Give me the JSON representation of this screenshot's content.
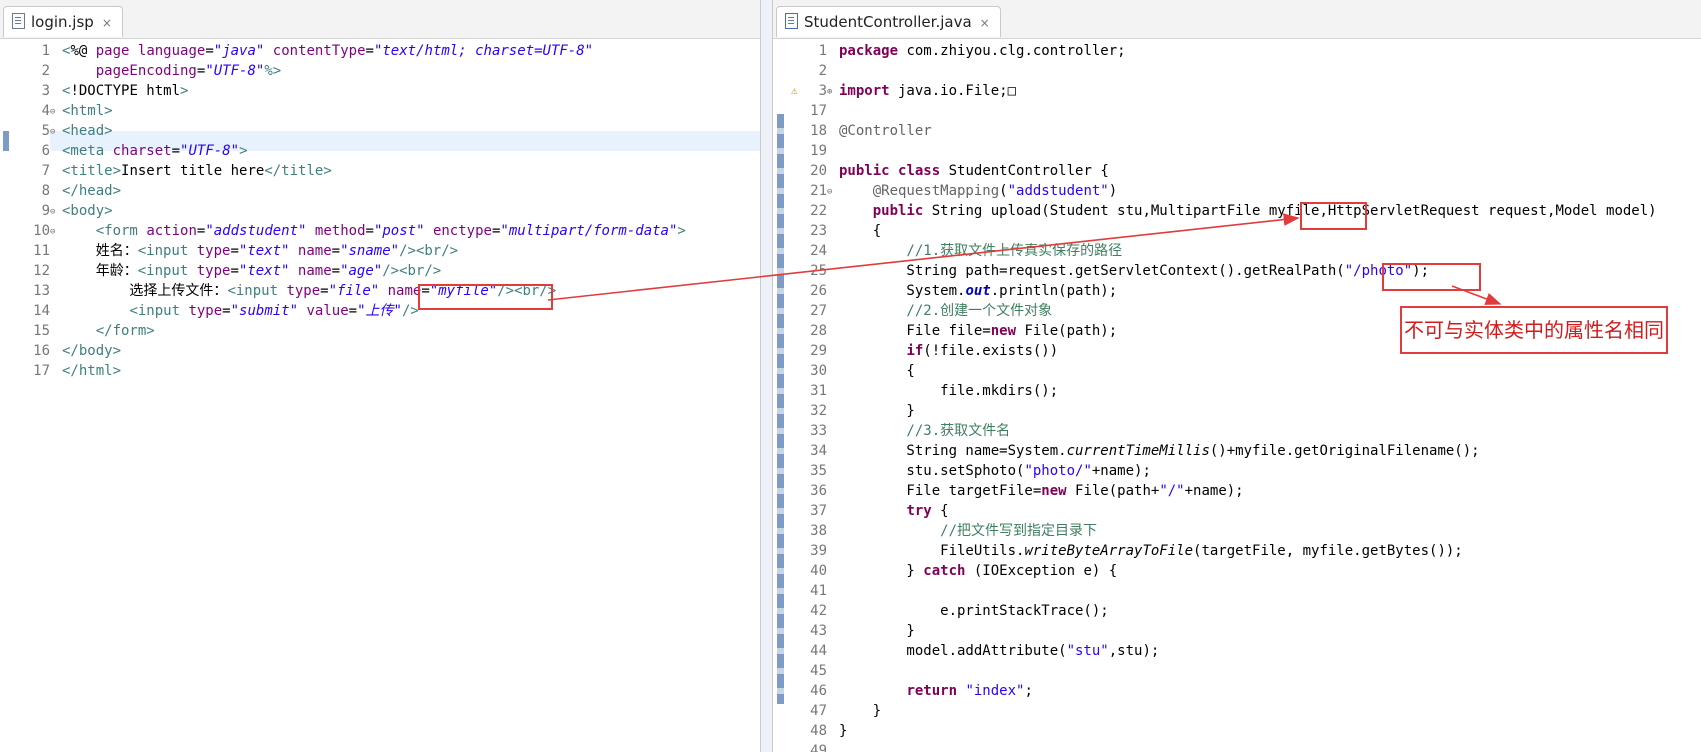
{
  "left": {
    "tab_title": "login.jsp",
    "tab_close": "×",
    "lines": [
      {
        "n": "1",
        "code": "<%@ page language=\"java\" contentType=\"text/html; charset=UTF-8\""
      },
      {
        "n": "2",
        "code": "    pageEncoding=\"UTF-8\"%>"
      },
      {
        "n": "3",
        "code": "<!DOCTYPE html>"
      },
      {
        "n": "4",
        "code": "<html>",
        "fold": "⊖"
      },
      {
        "n": "5",
        "code": "<head>",
        "fold": "⊖"
      },
      {
        "n": "6",
        "code": "<meta charset=\"UTF-8\">"
      },
      {
        "n": "7",
        "code": "<title>Insert title here</title>"
      },
      {
        "n": "8",
        "code": "</head>"
      },
      {
        "n": "9",
        "code": "<body>",
        "fold": "⊖"
      },
      {
        "n": "10",
        "code": "    <form action=\"addstudent\" method=\"post\" enctype=\"multipart/form-data\">",
        "fold": "⊖"
      },
      {
        "n": "11",
        "code": "    姓名：<input type=\"text\" name=\"sname\"/><br/>"
      },
      {
        "n": "12",
        "code": "    年龄：<input type=\"text\" name=\"age\"/><br/>"
      },
      {
        "n": "13",
        "code": "        选择上传文件：<input type=\"file\" name=\"myfile\"/><br/>"
      },
      {
        "n": "14",
        "code": "        <input type=\"submit\" value=\"上传\"/>"
      },
      {
        "n": "15",
        "code": "    </form>"
      },
      {
        "n": "16",
        "code": "</body>"
      },
      {
        "n": "17",
        "code": "</html>"
      }
    ]
  },
  "right": {
    "tab_title": "StudentController.java",
    "tab_close": "×",
    "lines": [
      {
        "n": "1",
        "code": "package com.zhiyou.clg.controller;"
      },
      {
        "n": "2",
        "code": ""
      },
      {
        "n": "3",
        "code": "import java.io.File;□",
        "fold": "⊕"
      },
      {
        "n": "17",
        "code": ""
      },
      {
        "n": "18",
        "code": "@Controller"
      },
      {
        "n": "19",
        "code": ""
      },
      {
        "n": "20",
        "code": "public class StudentController {"
      },
      {
        "n": "21",
        "code": "    @RequestMapping(\"addstudent\")",
        "fold": "⊖"
      },
      {
        "n": "22",
        "code": "    public String upload(Student stu,MultipartFile myfile,HttpServletRequest request,Model model)"
      },
      {
        "n": "23",
        "code": "    {"
      },
      {
        "n": "24",
        "code": "        //1.获取文件上传真实保存的路径"
      },
      {
        "n": "25",
        "code": "        String path=request.getServletContext().getRealPath(\"/photo\");"
      },
      {
        "n": "26",
        "code": "        System.out.println(path);"
      },
      {
        "n": "27",
        "code": "        //2.创建一个文件对象"
      },
      {
        "n": "28",
        "code": "        File file=new File(path);"
      },
      {
        "n": "29",
        "code": "        if(!file.exists())"
      },
      {
        "n": "30",
        "code": "        {"
      },
      {
        "n": "31",
        "code": "            file.mkdirs();"
      },
      {
        "n": "32",
        "code": "        }"
      },
      {
        "n": "33",
        "code": "        //3.获取文件名"
      },
      {
        "n": "34",
        "code": "        String name=System.currentTimeMillis()+myfile.getOriginalFilename();"
      },
      {
        "n": "35",
        "code": "        stu.setSphoto(\"photo/\"+name);"
      },
      {
        "n": "36",
        "code": "        File targetFile=new File(path+\"/\"+name);"
      },
      {
        "n": "37",
        "code": "        try {"
      },
      {
        "n": "38",
        "code": "            //把文件写到指定目录下"
      },
      {
        "n": "39",
        "code": "            FileUtils.writeByteArrayToFile(targetFile, myfile.getBytes());"
      },
      {
        "n": "40",
        "code": "        } catch (IOException e) {"
      },
      {
        "n": "41",
        "code": ""
      },
      {
        "n": "42",
        "code": "            e.printStackTrace();"
      },
      {
        "n": "43",
        "code": "        }"
      },
      {
        "n": "44",
        "code": "        model.addAttribute(\"stu\",stu);"
      },
      {
        "n": "45",
        "code": ""
      },
      {
        "n": "46",
        "code": "        return \"index\";"
      },
      {
        "n": "47",
        "code": "    }"
      },
      {
        "n": "48",
        "code": "}"
      },
      {
        "n": "49",
        "code": ""
      }
    ]
  },
  "annotation": {
    "text": "不可与实体类中的属性名相同"
  },
  "colors": {
    "keyword": "#7f0055",
    "string": "#2a00ff",
    "comment": "#3f7f5f",
    "tag": "#3f7f7f",
    "attr": "#7f007f",
    "annotation": "#646464",
    "field": "#0000c0",
    "highlight_box": "#e23b3b"
  }
}
